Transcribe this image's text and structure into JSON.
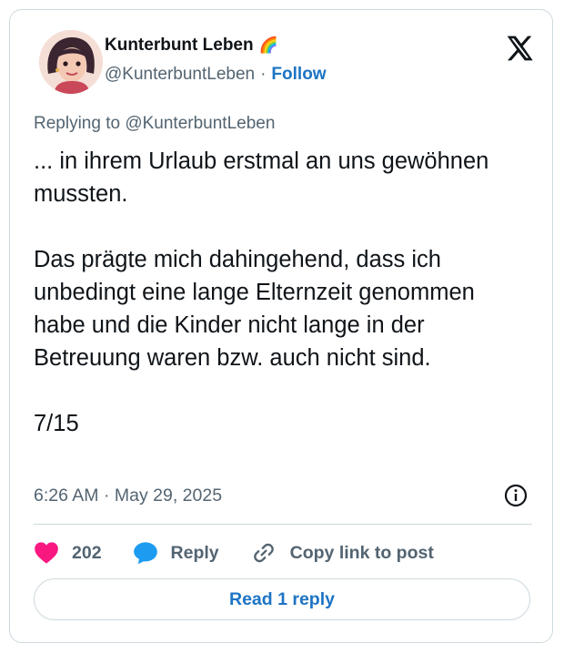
{
  "tweet": {
    "author_name": "Kunterbunt Leben",
    "author_emoji": "🌈",
    "handle": "@KunterbuntLeben",
    "follow_label": "Follow",
    "replying_to": "Replying to @KunterbuntLeben",
    "paragraphs": [
      "... in ihrem Urlaub erstmal an uns gewöhnen mussten.",
      "Das prägte mich dahingehend, dass ich unbedingt eine lange Elternzeit genommen habe und die Kinder nicht lange in der Betreuung waren bzw. auch nicht sind.",
      "7/15"
    ],
    "timestamp": "6:26 AM · May 29, 2025"
  },
  "actions": {
    "like_count": "202",
    "reply_label": "Reply",
    "copy_label": "Copy link to post"
  },
  "read_reply_label": "Read 1 reply",
  "icons": {
    "platform": "x-logo-icon",
    "info": "info-icon",
    "like": "heart-icon",
    "reply": "speech-bubble-icon",
    "copy": "link-icon"
  },
  "colors": {
    "like": "#f91880",
    "reply": "#1d9bf0",
    "link": "#1d74c4",
    "muted": "#536471"
  }
}
